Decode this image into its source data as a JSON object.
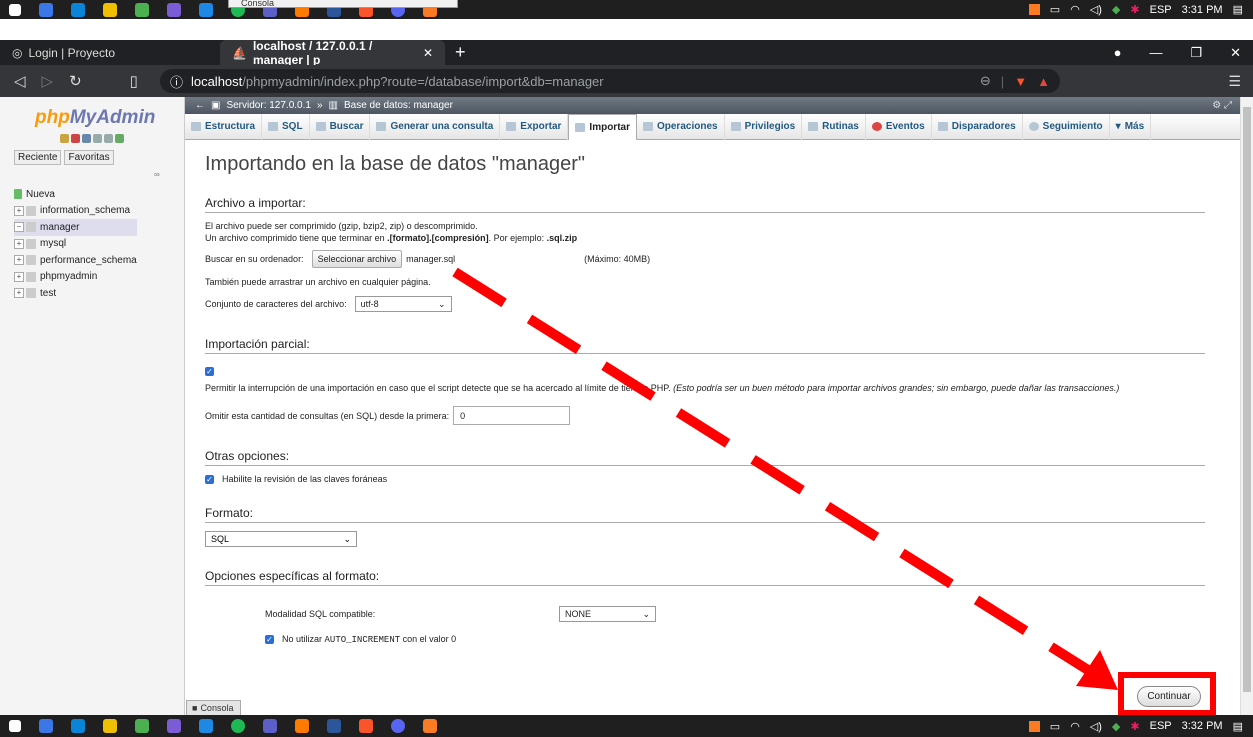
{
  "taskbar_top": {
    "console_label": "Consola"
  },
  "tray": {
    "lang": "ESP",
    "time_top": "3:31 PM",
    "time_bottom": "3:32 PM"
  },
  "browser": {
    "tabs": [
      {
        "label": "Login | Proyecto"
      },
      {
        "label": "localhost / 127.0.0.1 / manager | p"
      }
    ],
    "url_host": "localhost",
    "url_path": "/phpmyadmin/index.php?route=/database/import&db=manager"
  },
  "sidebar": {
    "logo_php": "php",
    "logo_my": "MyAdmin",
    "tab_recent": "Reciente",
    "tab_fav": "Favoritas",
    "tree": [
      "Nueva",
      "information_schema",
      "manager",
      "mysql",
      "performance_schema",
      "phpmyadmin",
      "test"
    ]
  },
  "breadcrumb": {
    "server": "Servidor: 127.0.0.1",
    "sep": "»",
    "db": "Base de datos: manager"
  },
  "menu": [
    "Estructura",
    "SQL",
    "Buscar",
    "Generar una consulta",
    "Exportar",
    "Importar",
    "Operaciones",
    "Privilegios",
    "Rutinas",
    "Eventos",
    "Disparadores",
    "Seguimiento",
    "Más"
  ],
  "page": {
    "title": "Importando en la base de datos \"manager\"",
    "file_section": "Archivo a importar:",
    "file_info1": "El archivo puede ser comprimido (gzip, bzip2, zip) o descomprimido.",
    "file_info2a": "Un archivo comprimido tiene que terminar en ",
    "file_info2b": ".[formato].[compresión]",
    "file_info2c": ". Por ejemplo: ",
    "file_info2d": ".sql.zip",
    "browse_label": "Buscar en su ordenador:",
    "browse_btn": "Seleccionar archivo",
    "file_name": "manager.sql",
    "max_size": "(Máximo: 40MB)",
    "drag_info": "También puede arrastrar un archivo en cualquier página.",
    "charset_label": "Conjunto de caracteres del archivo:",
    "charset_value": "utf-8",
    "partial_section": "Importación parcial:",
    "partial_text": "Permitir la interrupción de una importación en caso que el script detecte que se ha acercado al límite de tiempo PHP.",
    "partial_note": "(Esto podría ser un buen método para importar archivos grandes; sin embargo, puede dañar las transacciones.)",
    "skip_label": "Omitir esta cantidad de consultas (en SQL) desde la primera:",
    "skip_value": "0",
    "other_section": "Otras opciones:",
    "fk_label": "Habilite la revisión de las claves foráneas",
    "format_section": "Formato:",
    "format_value": "SQL",
    "specific_section": "Opciones específicas al formato:",
    "compat_label": "Modalidad SQL compatible:",
    "compat_value": "NONE",
    "autoinc_a": "No utilizar ",
    "autoinc_b": "AUTO_INCREMENT",
    "autoinc_c": " con el valor 0",
    "continue": "Continuar"
  },
  "console": "Consola",
  "colors": {
    "annotation": "#ff0000",
    "pma_blue": "#235a81"
  }
}
